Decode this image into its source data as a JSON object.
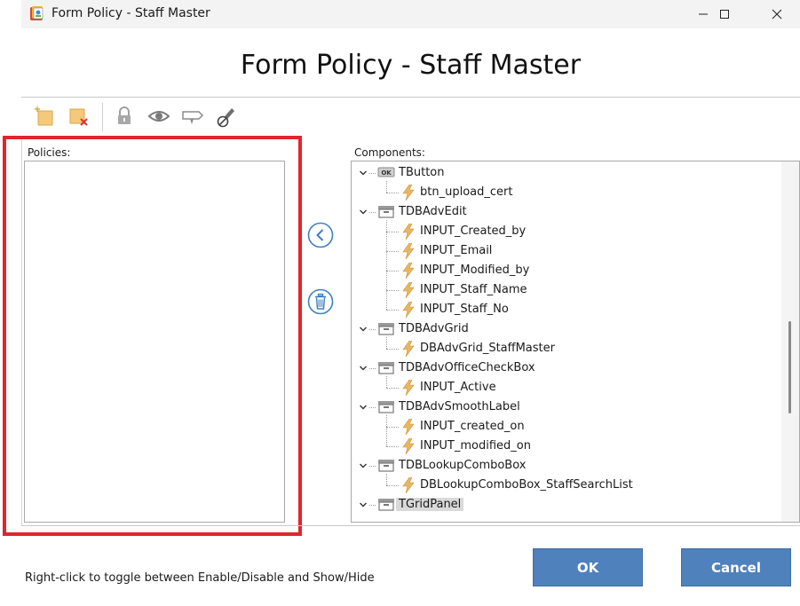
{
  "window": {
    "title": "Form Policy - Staff Master",
    "minimize_icon": "minimize-icon",
    "maximize_icon": "maximize-icon",
    "close_icon": "close-icon"
  },
  "heading": "Form Policy - Staff Master",
  "toolbar": {
    "items": [
      "add-policy-icon",
      "delete-policy-icon",
      "lock-icon",
      "eye-icon",
      "label-icon",
      "disable-edit-icon"
    ]
  },
  "policies": {
    "label": "Policies:",
    "items": []
  },
  "components": {
    "label": "Components:",
    "tree": [
      {
        "name": "TButton",
        "type": "group",
        "icon": "ok-button-icon",
        "children": [
          "btn_upload_cert"
        ]
      },
      {
        "name": "TDBAdvEdit",
        "type": "group",
        "icon": "component-group-icon",
        "children": [
          "INPUT_Created_by",
          "INPUT_Email",
          "INPUT_Modified_by",
          "INPUT_Staff_Name",
          "INPUT_Staff_No"
        ]
      },
      {
        "name": "TDBAdvGrid",
        "type": "group",
        "icon": "component-group-icon",
        "children": [
          "DBAdvGrid_StaffMaster"
        ]
      },
      {
        "name": "TDBAdvOfficeCheckBox",
        "type": "group",
        "icon": "component-group-icon",
        "children": [
          "INPUT_Active"
        ]
      },
      {
        "name": "TDBAdvSmoothLabel",
        "type": "group",
        "icon": "component-group-icon",
        "children": [
          "INPUT_created_on",
          "INPUT_modified_on"
        ]
      },
      {
        "name": "TDBLookupComboBox",
        "type": "group",
        "icon": "component-group-icon",
        "children": [
          "DBLookupComboBox_StaffSearchList"
        ]
      },
      {
        "name": "TGridPanel",
        "type": "group",
        "icon": "component-group-icon",
        "selected": true,
        "children": []
      }
    ]
  },
  "side_buttons": {
    "move_left_icon": "chevron-left-circle-icon",
    "delete_icon": "trash-circle-icon"
  },
  "hint": "Right-click to toggle between Enable/Disable and Show/Hide",
  "buttons": {
    "ok": "OK",
    "cancel": "Cancel"
  },
  "colors": {
    "button_bg": "#4f81bd",
    "highlight_border": "#e0262a",
    "component_icon": "#e8b760"
  }
}
